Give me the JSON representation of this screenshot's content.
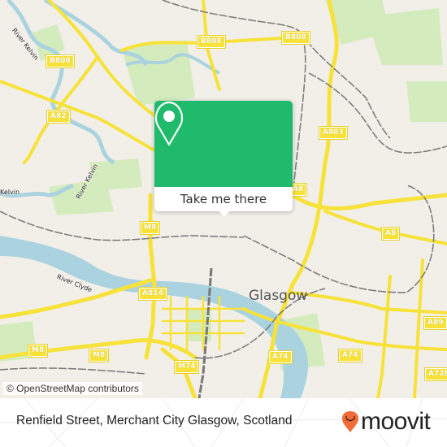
{
  "map": {
    "city_label": "Glasgow",
    "road_labels": [
      {
        "id": "b808-left",
        "text": "B808"
      },
      {
        "id": "b808-mid",
        "text": "B808"
      },
      {
        "id": "b808-right",
        "text": "B808"
      },
      {
        "id": "a82",
        "text": "A82"
      },
      {
        "id": "a803",
        "text": "A803"
      },
      {
        "id": "a8-near-popup",
        "text": "A8"
      },
      {
        "id": "a8-east",
        "text": "A8"
      },
      {
        "id": "m8-center",
        "text": "M8"
      },
      {
        "id": "a814",
        "text": "A814"
      },
      {
        "id": "m8-sw1",
        "text": "M8"
      },
      {
        "id": "m8-sw2",
        "text": "M8"
      },
      {
        "id": "m74",
        "text": "M74"
      },
      {
        "id": "a74-center",
        "text": "A74"
      },
      {
        "id": "a74-east",
        "text": "A74"
      },
      {
        "id": "a89",
        "text": "A89"
      },
      {
        "id": "a728",
        "text": "A728"
      }
    ],
    "river_labels": [
      {
        "id": "river-kelvin-nw",
        "text": "River Kelvin"
      },
      {
        "id": "river-kelvin-w",
        "text": "Kelvin"
      },
      {
        "id": "river-kelvin-mid",
        "text": "River Kelvin"
      },
      {
        "id": "river-clyde",
        "text": "River Clyde"
      }
    ],
    "attribution": "© OpenStreetMap contributors",
    "colors": {
      "land": "#f2efe9",
      "park": "#cdebb0",
      "water": "#aad3df",
      "major_road": "#f7e23a",
      "rail": "#777777"
    }
  },
  "popup": {
    "icon": "map-pin-icon",
    "button_label": "Take me there",
    "accent_color": "#1fba6b"
  },
  "footer": {
    "address": "Renfield Street, Merchant City Glasgow, Scotland",
    "brand": "moovit",
    "brand_color": "#f26b3a"
  }
}
